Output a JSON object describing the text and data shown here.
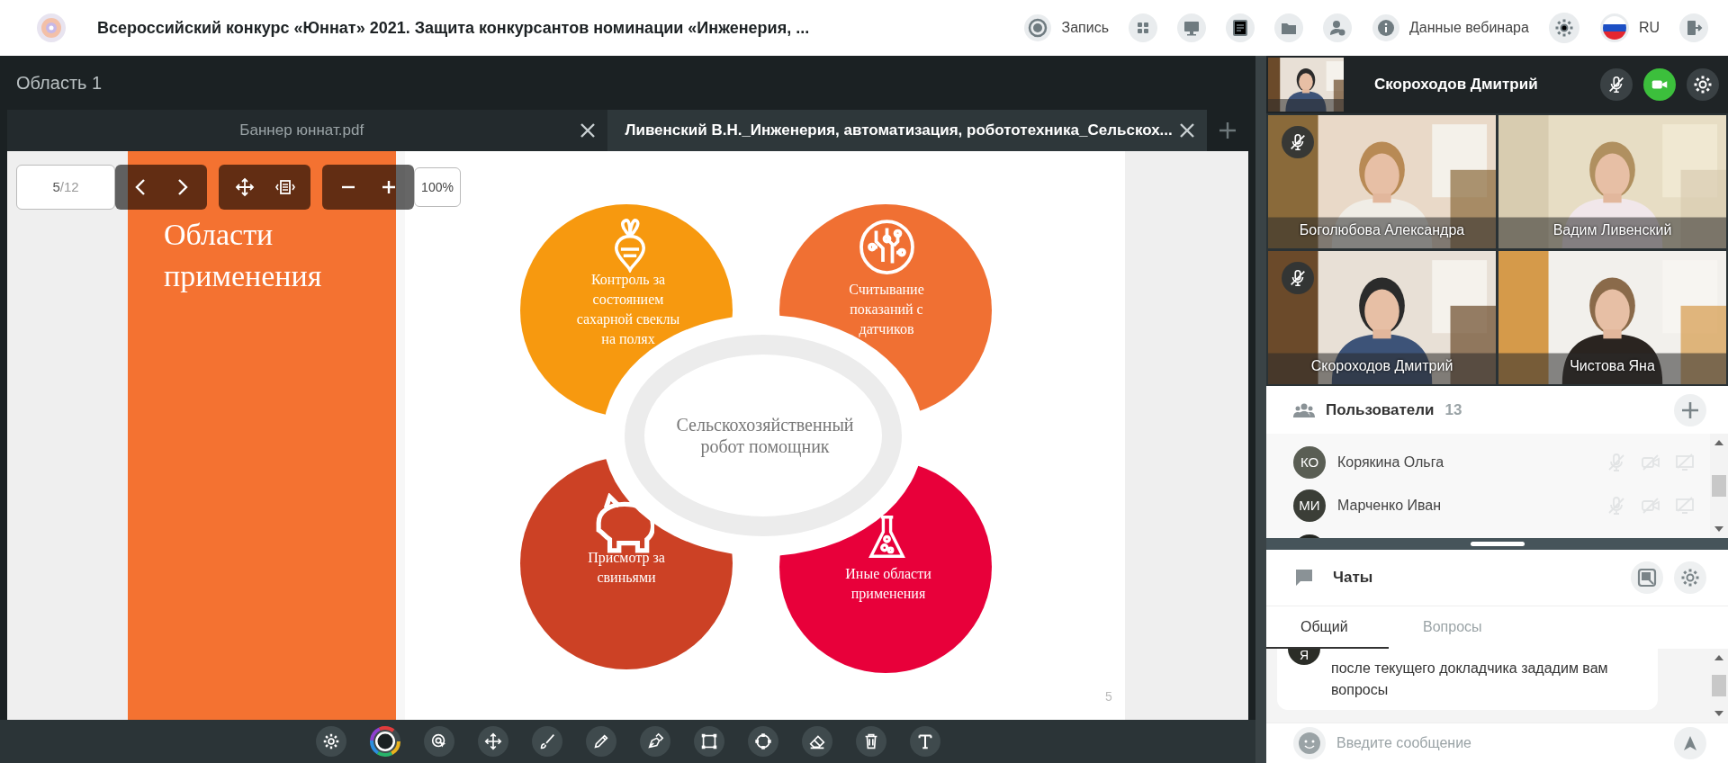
{
  "header": {
    "title": "Всероссийский конкурс «Юннат» 2021. Защита конкурсантов номинации «Инженерия, ...",
    "record_label": "Запись",
    "webinar_info_label": "Данные вебинара",
    "language": "RU"
  },
  "area": {
    "title": "Область 1"
  },
  "doc_tabs": [
    {
      "label": "Баннер юннат.pdf",
      "selected": false
    },
    {
      "label": "Ливенский В.Н._Инженерия, автоматизация, робототехника_Сельскох...",
      "selected": true
    }
  ],
  "pdf_toolbar": {
    "page": "5",
    "page_count": "/12",
    "zoom": "100%"
  },
  "slide": {
    "title": "Области применения",
    "center": "Сельскохозяйственный робот помощник",
    "page_number": "5",
    "areas": [
      {
        "kind": "beet",
        "text": "Контроль за состоянием сахарной свеклы на полях",
        "color": "#f7990f"
      },
      {
        "kind": "circuit",
        "text": "Считывание показаний с датчиков",
        "color": "#f07033"
      },
      {
        "kind": "pig",
        "text": "Присмотр за свиньями",
        "color": "#cc4125"
      },
      {
        "kind": "flask",
        "text": "Иные области применения",
        "color": "#e8003a"
      }
    ]
  },
  "self": {
    "name": "Скороходов Дмитрий",
    "mic_muted": true,
    "camera_on": true
  },
  "videos": [
    {
      "name": "Боголюбова Александра",
      "mic_muted": true
    },
    {
      "name": "Вадим Ливенский",
      "mic_muted": false
    },
    {
      "name": "Скороходов Дмитрий",
      "mic_muted": true
    },
    {
      "name": "Чистова Яна",
      "mic_muted": false
    }
  ],
  "users": {
    "title": "Пользователи",
    "count": "13",
    "list": [
      {
        "initials": "КО",
        "name": "Корякина Ольга"
      },
      {
        "initials": "МИ",
        "name": "Марченко Иван"
      }
    ]
  },
  "chat": {
    "title": "Чаты",
    "tabs": [
      {
        "label": "Общий",
        "selected": true
      },
      {
        "label": "Вопросы",
        "selected": false
      }
    ],
    "messages": [
      {
        "initials": "Я",
        "text": "после текущего докладчика зададим вам вопросы"
      }
    ],
    "placeholder": "Введите сообщение"
  }
}
